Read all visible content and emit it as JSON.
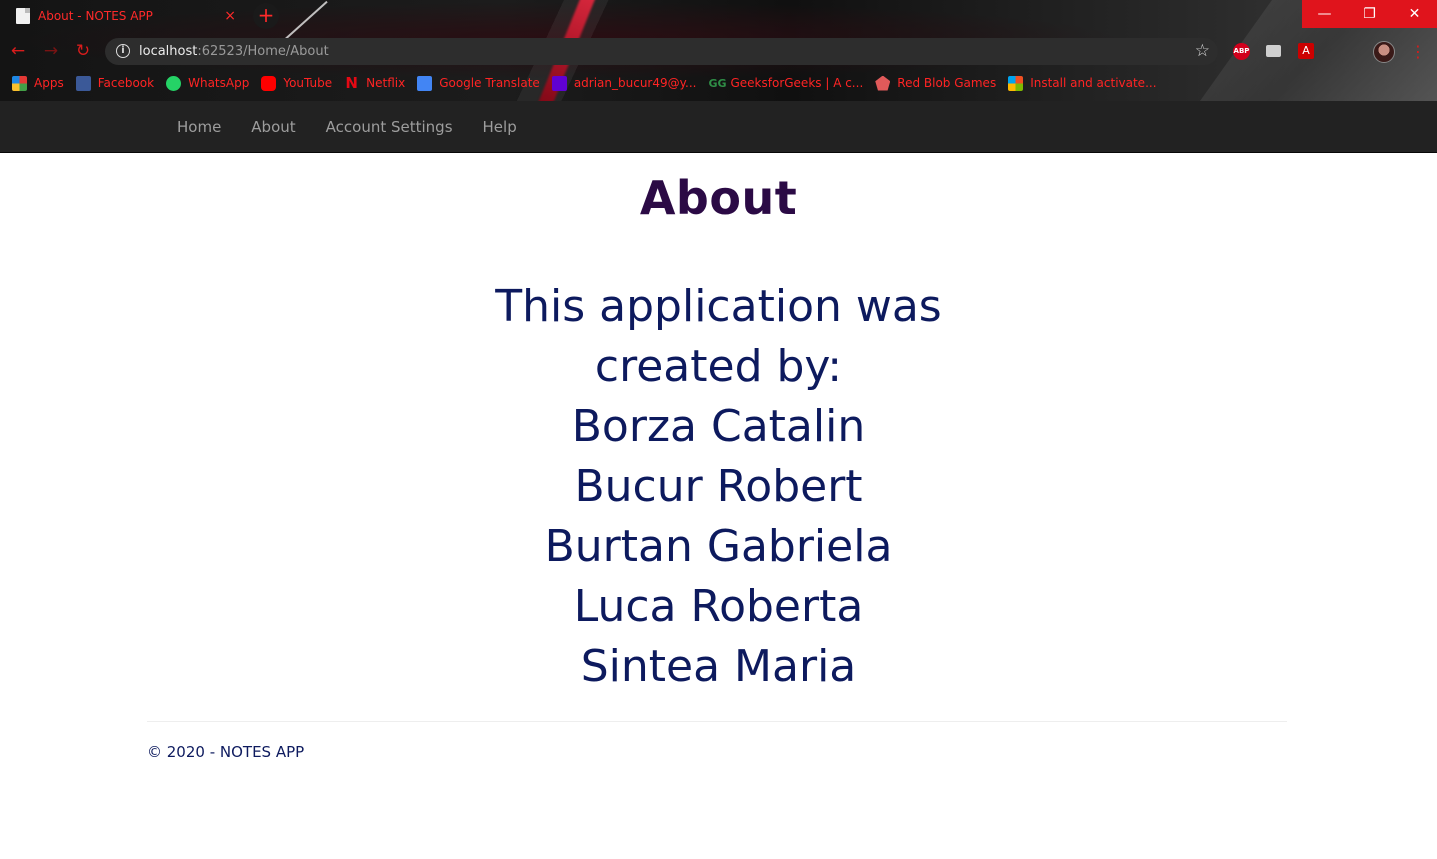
{
  "browser": {
    "tab_title": "About - NOTES APP",
    "tab_close": "×",
    "new_tab": "+",
    "window_controls": {
      "minimize": "—",
      "restore": "❐",
      "close": "✕"
    },
    "url_host": "localhost",
    "url_rest": ":62523/Home/About",
    "extensions": {
      "abp": "ABP",
      "pdf": "A"
    },
    "bookmarks": [
      {
        "label": "Apps",
        "icon": "apps-icon"
      },
      {
        "label": "Facebook",
        "icon": "facebook-icon"
      },
      {
        "label": "WhatsApp",
        "icon": "whatsapp-icon"
      },
      {
        "label": "YouTube",
        "icon": "youtube-icon"
      },
      {
        "label": "Netflix",
        "icon": "netflix-icon"
      },
      {
        "label": "Google Translate",
        "icon": "google-translate-icon"
      },
      {
        "label": "adrian_bucur49@y...",
        "icon": "yahoo-mail-icon"
      },
      {
        "label": "GeeksforGeeks | A c...",
        "icon": "geeksforgeeks-icon"
      },
      {
        "label": "Red Blob Games",
        "icon": "red-blob-games-icon"
      },
      {
        "label": "Install and activate...",
        "icon": "microsoft-icon"
      }
    ]
  },
  "site_nav": {
    "items": [
      "Home",
      "About",
      "Account Settings",
      "Help"
    ]
  },
  "page": {
    "title": "About",
    "lines": [
      "This application was",
      "created by:",
      "Borza Catalin",
      "Bucur Robert",
      "Burtan Gabriela",
      "Luca Roberta",
      "Sintea Maria"
    ],
    "footer": "© 2020 - NOTES APP"
  },
  "colors": {
    "accent_red": "#ff2424",
    "navbar_bg": "#222222",
    "title_color": "#2b0a45",
    "text_color": "#0d1a5e"
  }
}
